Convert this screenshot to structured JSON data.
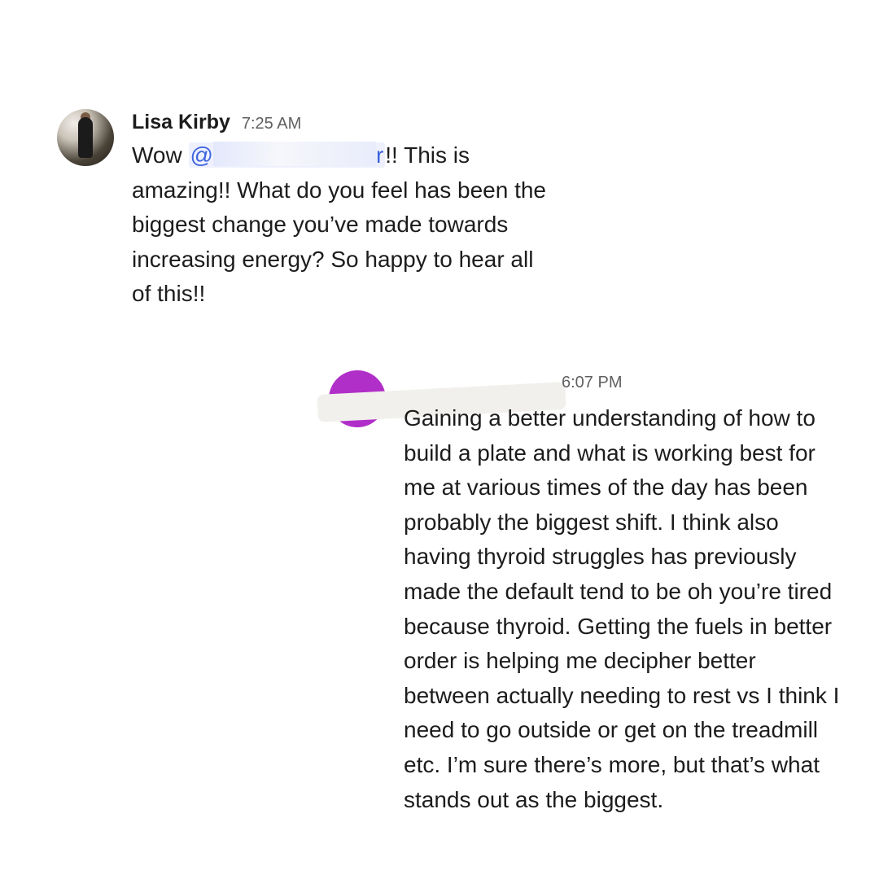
{
  "messages": [
    {
      "sender": "Lisa Kirby",
      "time": "7:25 AM",
      "text_before_mention": "Wow ",
      "mention": "@",
      "mention_trailing": "r",
      "text_after_mention": "!! This is amazing!! What do you feel has been the biggest change you’ve made towards increasing energy? So happy to hear all of this!!"
    },
    {
      "sender": "",
      "time": "6:07 PM",
      "text": "Gaining a better understanding of how to build a plate and what is working best for me at various times of the day has been probably the biggest shift. I think also having thyroid struggles has previously made the default tend to be oh you’re tired because thyroid. Getting the fuels in better order is helping me decipher better between actually needing to rest vs I think I need to go outside or get on the treadmill etc. I’m sure there’s more, but that’s what stands out as the biggest."
    }
  ],
  "colors": {
    "mention_text": "#3d63e0",
    "mention_bg": "#eef1fd",
    "avatar_purple": "#b12fc9",
    "timestamp": "#616061"
  },
  "icons": {
    "avatar_1": "user-photo-avatar",
    "avatar_2": "purple-avatar"
  }
}
